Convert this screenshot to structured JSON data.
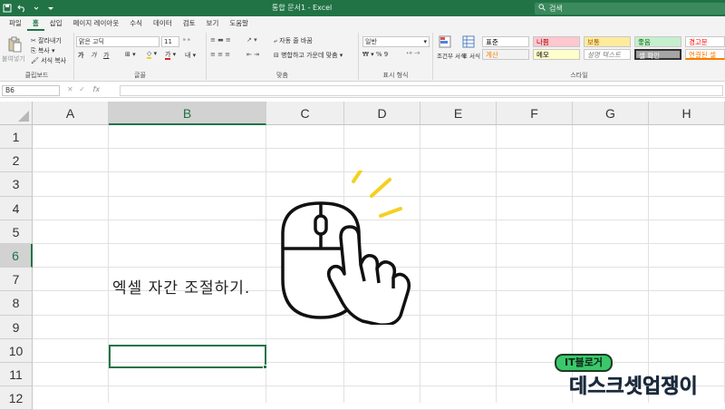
{
  "titlebar": {
    "title": "통합 문서1  -  Excel",
    "search_placeholder": "검색",
    "icons": [
      "save-icon",
      "undo-icon",
      "redo-icon",
      "customize-icon"
    ]
  },
  "tabs": [
    "파일",
    "홈",
    "삽입",
    "페이지 레이아웃",
    "수식",
    "데이터",
    "검토",
    "보기",
    "도움말"
  ],
  "active_tab": "홈",
  "ribbon": {
    "clipboard": {
      "paste": "붙여넣기",
      "cut": "잘라내기",
      "copy": "복사",
      "format_painter": "서식 복사",
      "label": "클립보드"
    },
    "font": {
      "name": "맑은 고딕",
      "size": "11",
      "bold": "가",
      "italic": "가",
      "underline": "가",
      "label": "글꼴"
    },
    "alignment": {
      "wrap": "자동 줄 바꿈",
      "merge": "병합하고 가운데 맞춤",
      "label": "맞춤"
    },
    "number": {
      "format": "일반",
      "label": "표시 형식"
    },
    "styles": {
      "conditional": "조건부 서식",
      "table": "표 서식",
      "cells": [
        {
          "text": "표준",
          "bg": "#ffffff",
          "fg": "#000000"
        },
        {
          "text": "나쁨",
          "bg": "#ffc7ce",
          "fg": "#9c0006"
        },
        {
          "text": "보통",
          "bg": "#ffeb9c",
          "fg": "#9c5700"
        },
        {
          "text": "좋음",
          "bg": "#c6efce",
          "fg": "#006100"
        },
        {
          "text": "경고문",
          "bg": "#ffffff",
          "fg": "#ff0000"
        },
        {
          "text": "계산",
          "bg": "#f2f2f2",
          "fg": "#fa7d00"
        },
        {
          "text": "메모",
          "bg": "#ffffcc",
          "fg": "#000000"
        },
        {
          "text": "설명 텍스트",
          "bg": "#ffffff",
          "fg": "#7f7f7f"
        },
        {
          "text": "셀 확인",
          "bg": "#a5a5a5",
          "fg": "#ffffff"
        },
        {
          "text": "연결된 셀",
          "bg": "#ffffff",
          "fg": "#fa7d00"
        }
      ],
      "label": "스타일"
    }
  },
  "formula_bar": {
    "name_box": "B6",
    "fx": "fx",
    "value": ""
  },
  "columns": [
    "A",
    "B",
    "C",
    "D",
    "E",
    "F",
    "G",
    "H"
  ],
  "rows": [
    "1",
    "2",
    "3",
    "4",
    "5",
    "6",
    "7",
    "8",
    "9",
    "10",
    "11",
    "12"
  ],
  "selected_column": "B",
  "selected_row": "6",
  "cell_content": {
    "address": "B3",
    "text": "엑셀 자간 조절하기."
  },
  "watermark": {
    "tag": "IT블로거",
    "name": "데스크셋업쟁이"
  },
  "colors": {
    "accent": "#217346",
    "watermark_green": "#3ac86a",
    "highlight": "#f5d020"
  }
}
